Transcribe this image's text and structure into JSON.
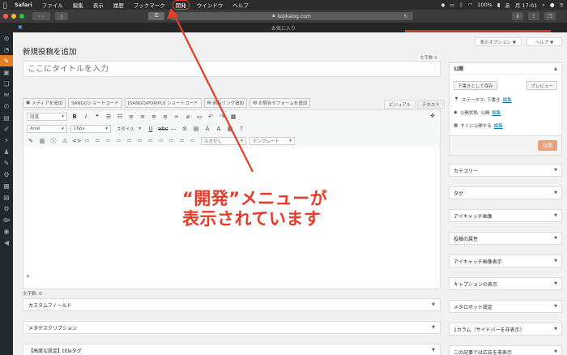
{
  "menubar": {
    "app": "Safari",
    "items": [
      "ファイル",
      "編集",
      "表示",
      "履歴",
      "ブックマーク",
      "開発",
      "ウインドウ",
      "ヘルプ"
    ],
    "highlighted_index": 5,
    "battery": "100%",
    "clock": "月 17:01"
  },
  "browser": {
    "url": "kojikalog.com",
    "tab_title": "お気に入り"
  },
  "wp": {
    "screen_options": "表示オプション ▼",
    "help": "ヘルプ ▼",
    "page_title": "新規投稿を追加",
    "char_count_top": "文字数 0",
    "title_placeholder": "ここにタイトルを入力",
    "media_buttons": [
      "メディアを追加",
      "SANGOショートコード",
      "[SANGO/PORIPU] ショートコード",
      "商品リンク追加",
      "お問合せフォームを追加"
    ],
    "editor_tabs": [
      "ビジュアル",
      "テキスト"
    ],
    "format_select": "段落",
    "font_select": "Arial",
    "size_select": "16px",
    "style_label": "スタイル",
    "fukidashi_select": "ふきだし",
    "template_select": "テンプレート",
    "path": "P",
    "word_count": "文字数: 0",
    "meta_boxes": [
      "カスタムフィールド",
      "メタデスクリプション",
      "【高度な設定】titleタグ"
    ]
  },
  "publish": {
    "header": "公開",
    "save_draft": "下書きとして保存",
    "preview": "プレビュー",
    "status_label": "ステータス: 下書き",
    "visibility_label": "公開状態: 公開",
    "schedule_label": "すぐに公開する",
    "edit_link": "編集",
    "publish_button": "公開"
  },
  "sidebar_boxes": [
    "カテゴリー",
    "タグ",
    "アイキャッチ画像",
    "投稿の属性",
    "アイキャッチ画像表示",
    "キャプションの表示",
    "メタロボット設定",
    "1カラム（サイドバーを非表示）",
    "この記事では広告を非表示"
  ],
  "annotation": {
    "line1": "“開発”メニューが",
    "line2": "表示されています",
    "color": "#e53c2a"
  }
}
